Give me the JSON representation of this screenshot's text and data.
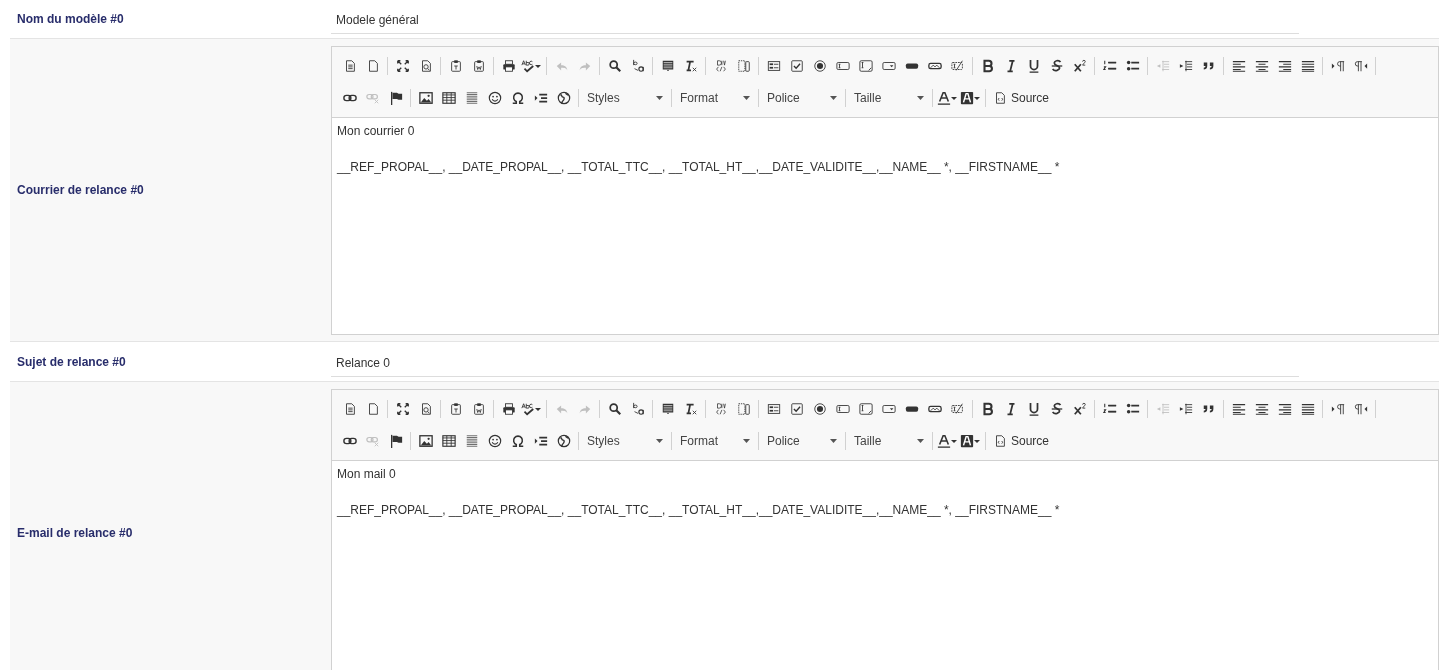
{
  "rows": [
    {
      "kind": "input",
      "label": "Nom du modèle #0",
      "value": "Modele général"
    },
    {
      "kind": "editor",
      "label": "Courrier de relance #0",
      "toolbar": {
        "undo": {
          "disabled": true
        },
        "redo": {
          "disabled": true
        },
        "unlink": {
          "disabled": true
        },
        "outdent": {
          "disabled": true
        },
        "combos": [
          {
            "label": "Styles"
          },
          {
            "label": "Format"
          },
          {
            "label": "Police"
          },
          {
            "label": "Taille"
          }
        ],
        "source": "Source"
      },
      "paragraphs": [
        "Mon courrier 0",
        "__REF_PROPAL__, __DATE_PROPAL__, __TOTAL_TTC__, __TOTAL_HT__,__DATE_VALIDITE__,__NAME__ *, __FIRSTNAME__ *"
      ]
    },
    {
      "kind": "input",
      "label": "Sujet de relance #0",
      "value": "Relance 0"
    },
    {
      "kind": "editor",
      "label": "E-mail de relance #0",
      "toolbar": {
        "undo": {
          "disabled": true
        },
        "redo": {
          "disabled": true
        },
        "unlink": {
          "disabled": true
        },
        "outdent": {
          "disabled": true
        },
        "combos": [
          {
            "label": "Styles"
          },
          {
            "label": "Format"
          },
          {
            "label": "Police"
          },
          {
            "label": "Taille"
          }
        ],
        "source": "Source"
      },
      "paragraphs": [
        "Mon mail 0",
        "__REF_PROPAL__, __DATE_PROPAL__, __TOTAL_TTC__, __TOTAL_HT__,__DATE_VALIDITE__,__NAME__ *, __FIRSTNAME__ *"
      ]
    }
  ]
}
